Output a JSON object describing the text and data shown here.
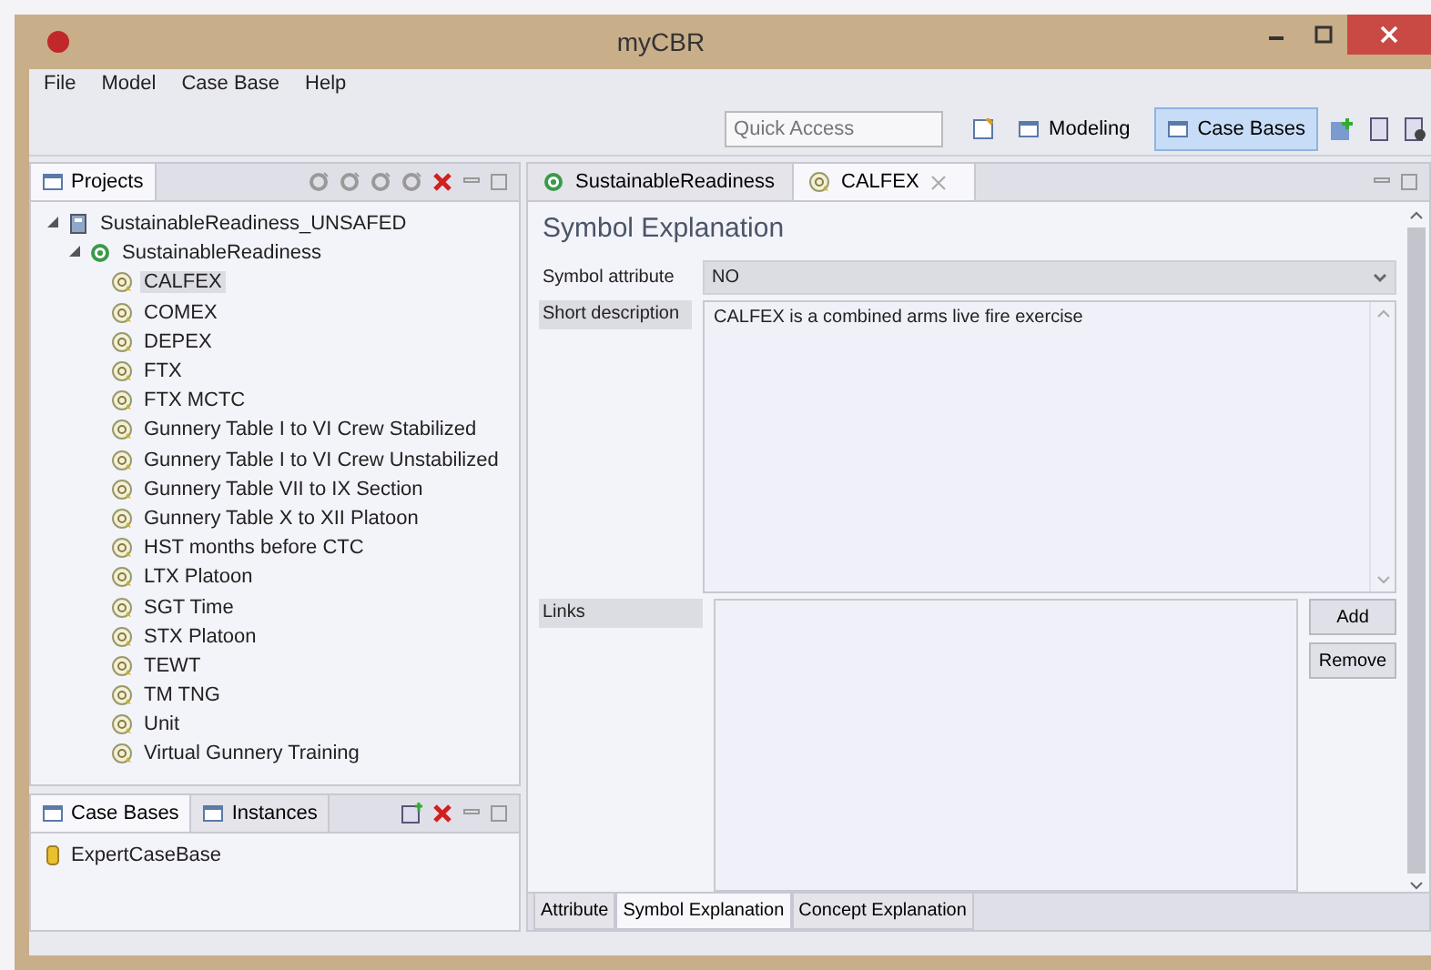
{
  "window": {
    "title": "myCBR"
  },
  "menu": [
    "File",
    "Model",
    "Case Base",
    "Help"
  ],
  "toolbar": {
    "quick_access": {
      "placeholder": "Quick Access"
    },
    "perspectives": [
      {
        "label": "Modeling",
        "selected": false
      },
      {
        "label": "Case Bases",
        "selected": true
      }
    ]
  },
  "projects_view": {
    "title": "Projects",
    "tree": [
      {
        "label": "SustainableReadiness_UNSAFED",
        "kind": "project",
        "expanded": true,
        "selected": false,
        "children": [
          {
            "label": "SustainableReadiness",
            "kind": "concept",
            "expanded": true,
            "selected": false,
            "children": [
              {
                "label": "CALFEX",
                "kind": "attribute",
                "selected": true
              },
              {
                "label": "COMEX",
                "kind": "attribute",
                "selected": false
              },
              {
                "label": "DEPEX",
                "kind": "attribute",
                "selected": false
              },
              {
                "label": "FTX",
                "kind": "attribute",
                "selected": false
              },
              {
                "label": "FTX MCTC",
                "kind": "attribute",
                "selected": false
              },
              {
                "label": "Gunnery Table I to VI Crew Stabilized",
                "kind": "attribute",
                "selected": false
              },
              {
                "label": "Gunnery Table I to VI Crew Unstabilized",
                "kind": "attribute",
                "selected": false
              },
              {
                "label": "Gunnery Table VII to IX Section",
                "kind": "attribute",
                "selected": false
              },
              {
                "label": "Gunnery Table X to XII Platoon",
                "kind": "attribute",
                "selected": false
              },
              {
                "label": "HST months before CTC",
                "kind": "attribute",
                "selected": false
              },
              {
                "label": "LTX Platoon",
                "kind": "attribute",
                "selected": false
              },
              {
                "label": "SGT Time",
                "kind": "attribute",
                "selected": false
              },
              {
                "label": "STX Platoon",
                "kind": "attribute",
                "selected": false
              },
              {
                "label": "TEWT",
                "kind": "attribute",
                "selected": false
              },
              {
                "label": "TM TNG",
                "kind": "attribute",
                "selected": false
              },
              {
                "label": "Unit",
                "kind": "attribute",
                "selected": false
              },
              {
                "label": "Virtual Gunnery Training",
                "kind": "attribute",
                "selected": false
              }
            ]
          }
        ]
      }
    ]
  },
  "case_bases_view": {
    "tabs": [
      {
        "label": "Case Bases",
        "selected": true
      },
      {
        "label": "Instances",
        "selected": false
      }
    ],
    "items": [
      "ExpertCaseBase"
    ]
  },
  "editor": {
    "tabs": [
      {
        "label": "SustainableReadiness",
        "kind": "concept",
        "selected": false
      },
      {
        "label": "CALFEX",
        "kind": "attribute",
        "selected": true
      }
    ],
    "heading": "Symbol Explanation",
    "symbol_attribute": {
      "label": "Symbol attribute",
      "value": "NO"
    },
    "short_description": {
      "label": "Short description",
      "value": "CALFEX is a combined arms live fire exercise"
    },
    "links": {
      "label": "Links",
      "buttons": [
        "Add",
        "Remove"
      ]
    },
    "bottom_tabs": [
      {
        "label": "Attribute",
        "selected": false
      },
      {
        "label": "Symbol Explanation",
        "selected": true
      },
      {
        "label": "Concept Explanation",
        "selected": false
      }
    ]
  }
}
